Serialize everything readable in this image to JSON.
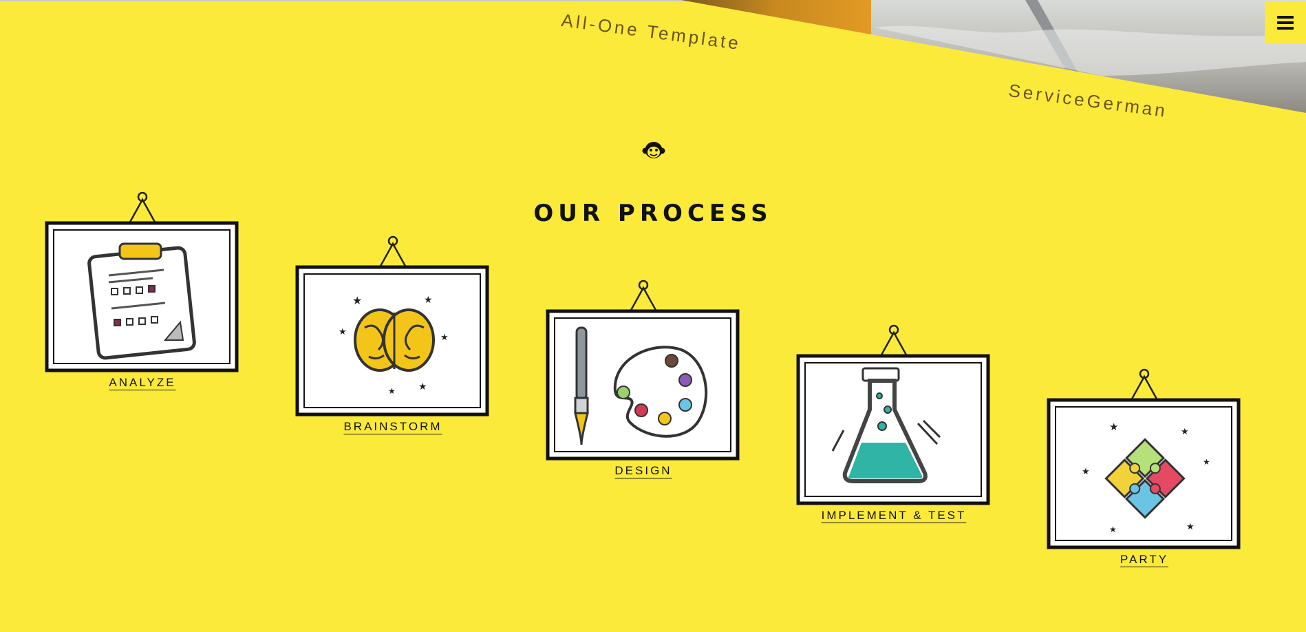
{
  "header": {
    "banner_text_1": "All-One Template",
    "banner_text_2": "ServiceGerman",
    "menu_icon": "hamburger-menu-icon"
  },
  "brand_icon": "monkey-face-icon",
  "process": {
    "title": "OUR PROCESS",
    "steps": [
      {
        "label": "ANALYZE",
        "icon": "clipboard-icon"
      },
      {
        "label": "BRAINSTORM",
        "icon": "brain-icon"
      },
      {
        "label": "DESIGN",
        "icon": "paint-palette-icon"
      },
      {
        "label": "IMPLEMENT & TEST",
        "icon": "flask-icon"
      },
      {
        "label": "PARTY",
        "icon": "puzzle-icon"
      }
    ]
  },
  "colors": {
    "background": "#fcea3a",
    "text": "#111111",
    "accent_yellow": "#f2c518",
    "teal": "#2fb4a5"
  }
}
